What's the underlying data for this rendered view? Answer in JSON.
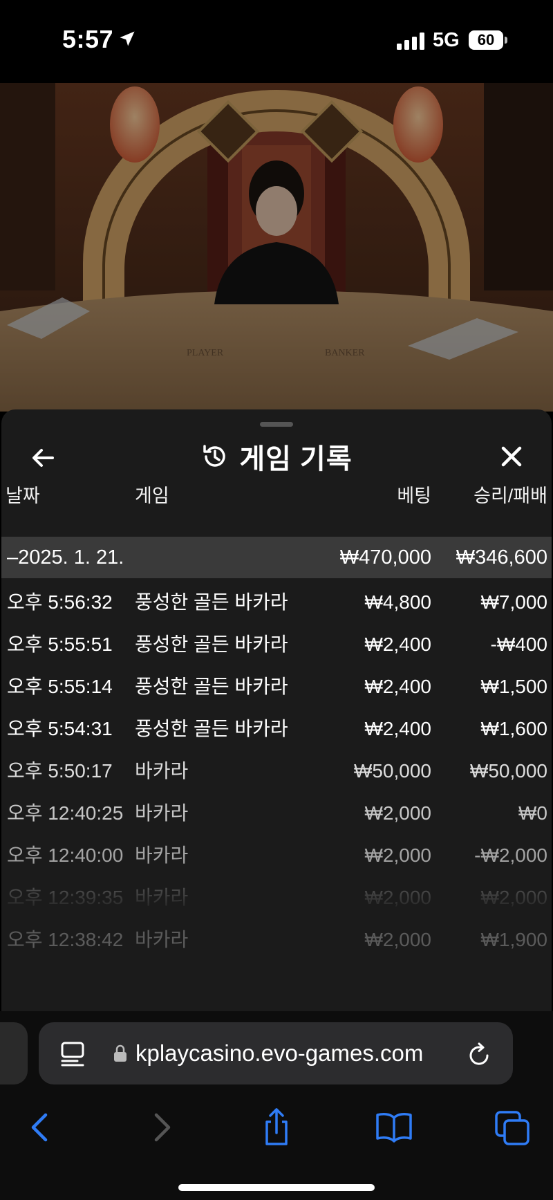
{
  "status_bar": {
    "time": "5:57",
    "network": "5G",
    "battery": "60"
  },
  "panel": {
    "title": "게임 기록",
    "columns": {
      "date": "날짜",
      "game": "게임",
      "bet": "베팅",
      "win_loss": "승리/패배"
    },
    "date_group": {
      "date": "–2025. 1. 21.",
      "bet": "₩470,000",
      "win_loss": "₩346,600"
    },
    "rows": [
      {
        "time": "오후 5:56:32",
        "game": "풍성한 골든 바카라",
        "bet": "₩4,800",
        "win_loss": "₩7,000"
      },
      {
        "time": "오후 5:55:51",
        "game": "풍성한 골든 바카라",
        "bet": "₩2,400",
        "win_loss": "-₩400"
      },
      {
        "time": "오후 5:55:14",
        "game": "풍성한 골든 바카라",
        "bet": "₩2,400",
        "win_loss": "₩1,500"
      },
      {
        "time": "오후 5:54:31",
        "game": "풍성한 골든 바카라",
        "bet": "₩2,400",
        "win_loss": "₩1,600"
      },
      {
        "time": "오후 5:50:17",
        "game": "바카라",
        "bet": "₩50,000",
        "win_loss": "₩50,000"
      },
      {
        "time": "오후 12:40:25",
        "game": "바카라",
        "bet": "₩2,000",
        "win_loss": "₩0"
      },
      {
        "time": "오후 12:40:00",
        "game": "바카라",
        "bet": "₩2,000",
        "win_loss": "-₩2,000"
      },
      {
        "time": "오후 12:39:35",
        "game": "바카라",
        "bet": "₩2,000",
        "win_loss": "₩2,000"
      },
      {
        "time": "오후 12:38:42",
        "game": "바카라",
        "bet": "₩2,000",
        "win_loss": "₩1,900"
      }
    ],
    "icons": {
      "back": "arrow-left-icon",
      "history": "history-icon",
      "close": "close-icon"
    }
  },
  "scene": {
    "table_labels": [
      "PLAYER",
      "BANKER"
    ]
  },
  "browser": {
    "url": "kplaycasino.evo-games.com",
    "icons": [
      "reader-icon",
      "lock-icon",
      "reload-icon",
      "back-icon",
      "forward-icon",
      "share-icon",
      "bookmarks-icon",
      "tabs-icon"
    ],
    "accent": "#2f7cf6"
  }
}
